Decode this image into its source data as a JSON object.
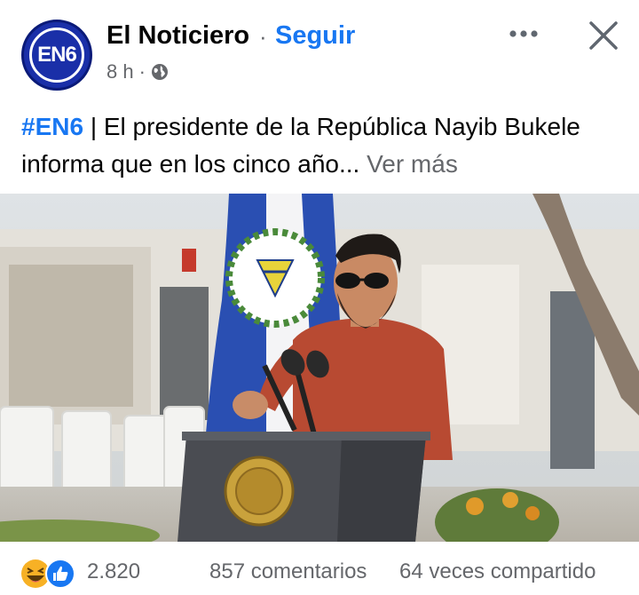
{
  "header": {
    "avatar_text": "EN6",
    "page_name": "El Noticiero",
    "separator": "·",
    "follow_label": "Seguir",
    "time": "8 h",
    "meta_separator": "·",
    "privacy_icon": "globe-icon",
    "more_icon": "more-horizontal-icon",
    "close_icon": "close-icon"
  },
  "post": {
    "hashtag": "#EN6",
    "text": " | El presidente de la República Nayib Bukele informa que en los cinco año...",
    "see_more": " Ver más",
    "image_icon": "photo-president-podium"
  },
  "footer": {
    "reaction_icons": [
      "haha-icon",
      "like-icon"
    ],
    "reaction_count": "2.820",
    "comments": "857 comentarios",
    "shares": "64 veces compartido"
  },
  "colors": {
    "accent": "#1877f2",
    "secondary_text": "#65676b",
    "avatar_bg": "#1a2fa8"
  }
}
